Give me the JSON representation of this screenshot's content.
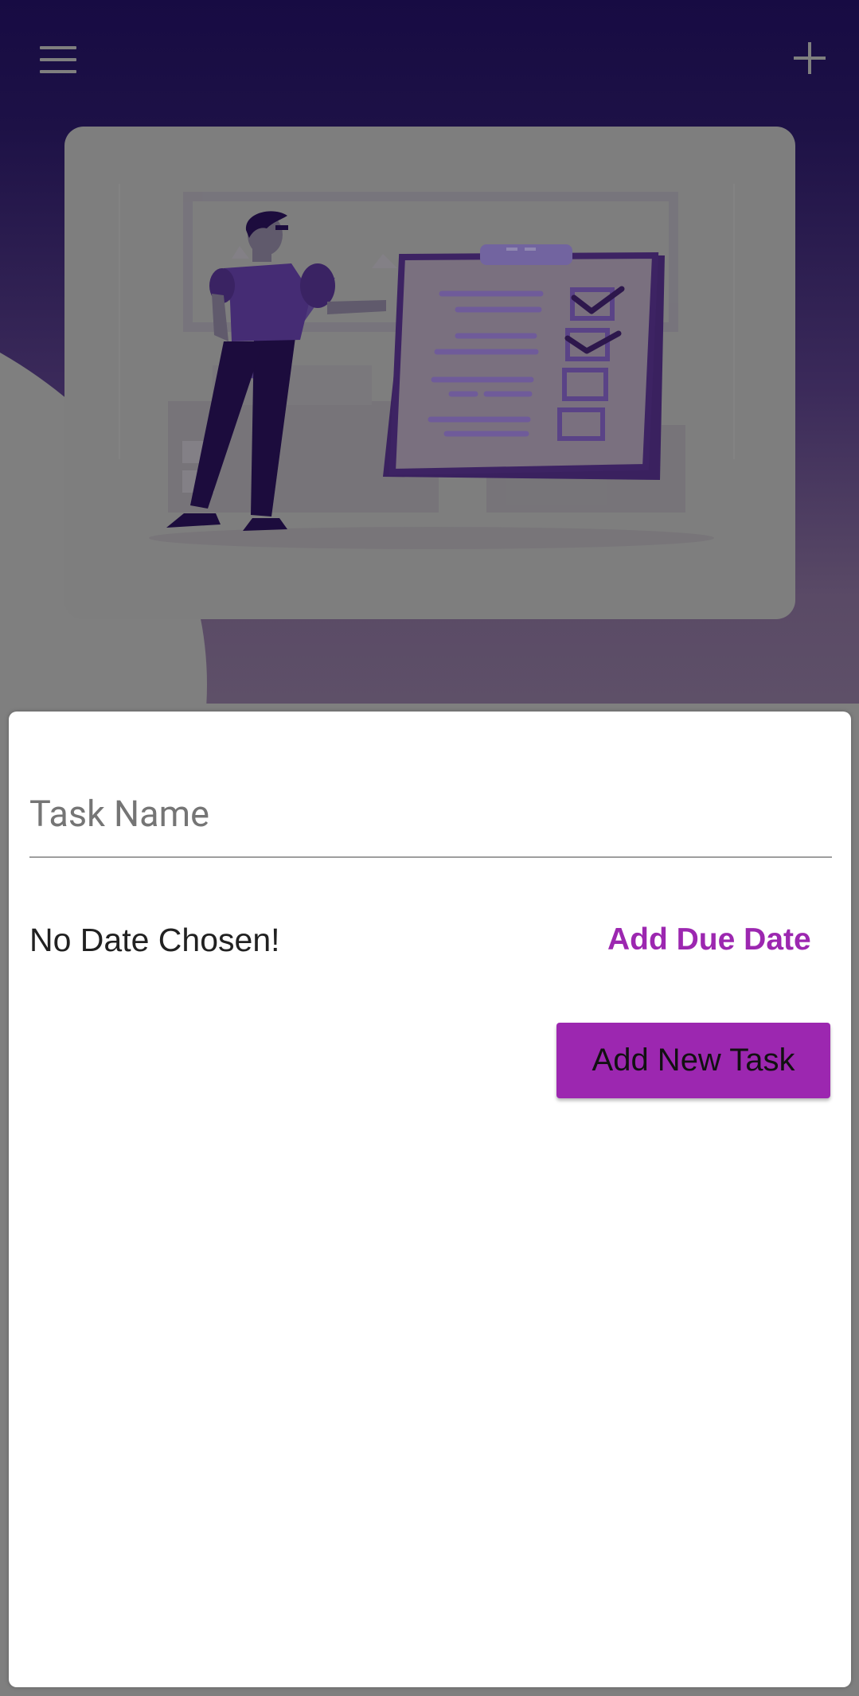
{
  "app_bar": {
    "menu_icon": "menu-icon",
    "add_icon": "plus-icon"
  },
  "hero": {
    "illustration": "person-with-checklist-illustration"
  },
  "form": {
    "task_name_placeholder": "Task Name",
    "task_name_value": "",
    "date_status": "No Date Chosen!",
    "add_due_date_label": "Add Due Date",
    "submit_label": "Add New Task"
  },
  "colors": {
    "accent": "#9c27b0",
    "header_top": "#170b43",
    "illustration_purple": "#3e2568",
    "scrim_gray": "#7f7f7f"
  }
}
